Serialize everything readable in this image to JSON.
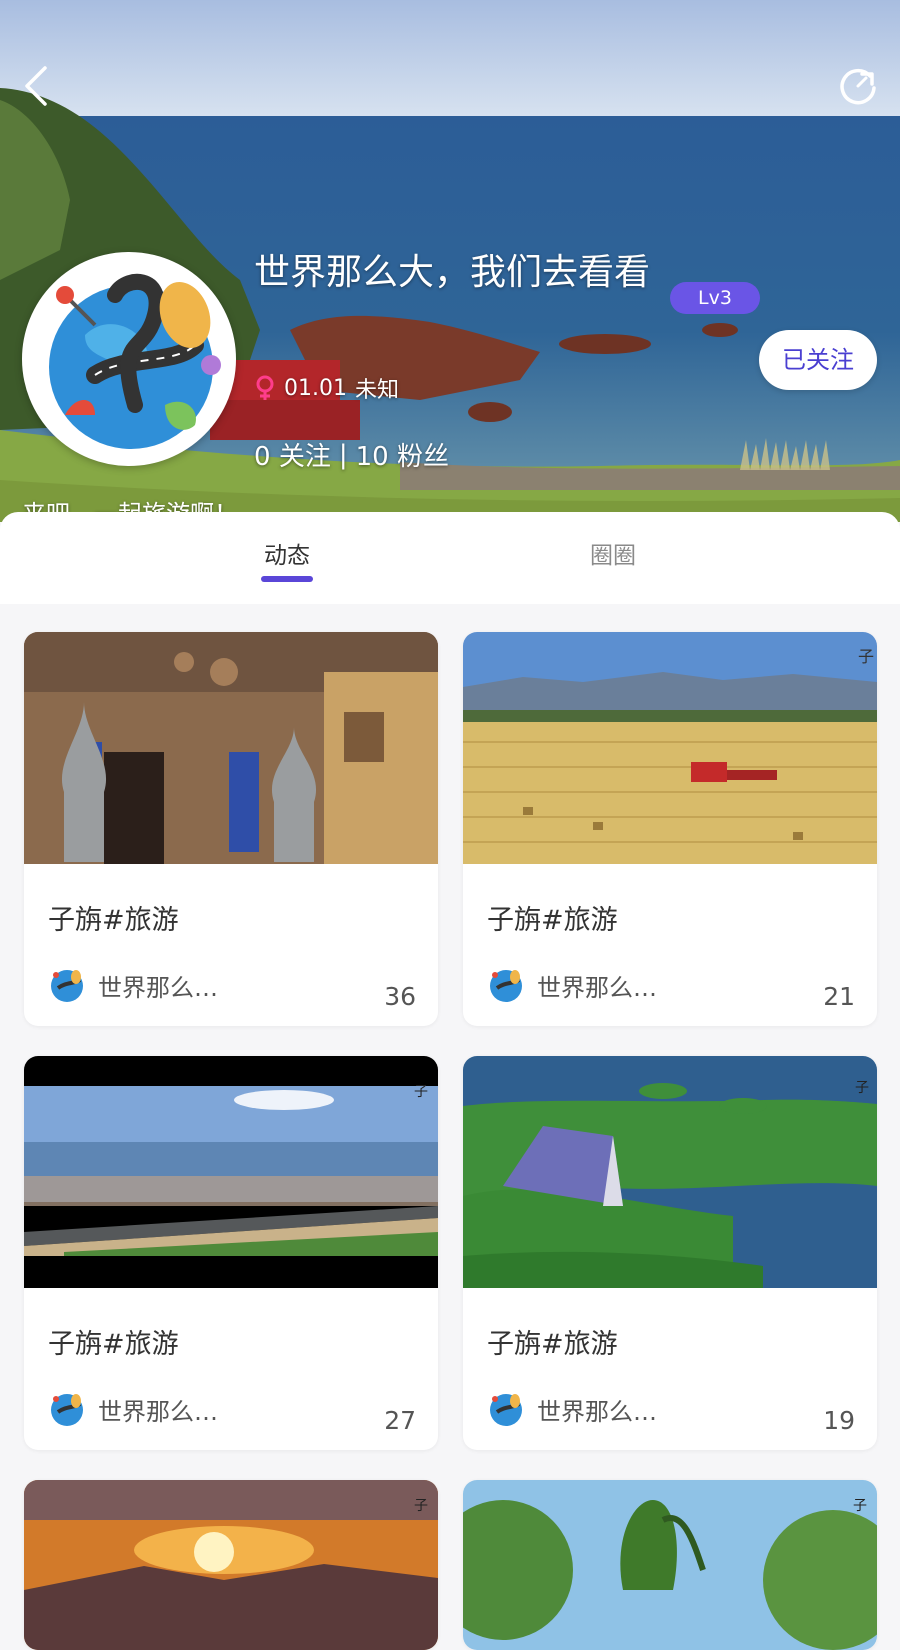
{
  "header": {
    "back_icon": "chevron-left-icon",
    "refresh_icon": "refresh-icon",
    "profile_name": "世界那么大，我们去看看",
    "level_badge": "Lv3",
    "follow_label": "已关注",
    "gender_icon": "female-icon",
    "birthday": "01.01",
    "location": "未知",
    "following_count": "0",
    "following_label": "关注",
    "separator": "|",
    "followers_count": "10",
    "followers_label": "粉丝",
    "signature": "来吧，一起旅游啊！"
  },
  "tabs": [
    {
      "label": "动态",
      "active": true
    },
    {
      "label": "圈圈",
      "active": false
    }
  ],
  "posts": [
    {
      "title": "子旃#旅游",
      "author": "世界那么…",
      "count": "36",
      "thumb": "market-photo"
    },
    {
      "title": "子旃#旅游",
      "author": "世界那么…",
      "count": "21",
      "thumb": "field-photo"
    },
    {
      "title": "子旃#旅游",
      "author": "世界那么…",
      "count": "27",
      "thumb": "lake-road-photo"
    },
    {
      "title": "子旃#旅游",
      "author": "世界那么…",
      "count": "19",
      "thumb": "wetland-cabin-photo"
    },
    {
      "thumb": "sunset-photo"
    },
    {
      "thumb": "trees-photo"
    }
  ],
  "colors": {
    "accent": "#5a46d8",
    "badge": "#6a55e6",
    "follow_text": "#4a3fd1"
  }
}
